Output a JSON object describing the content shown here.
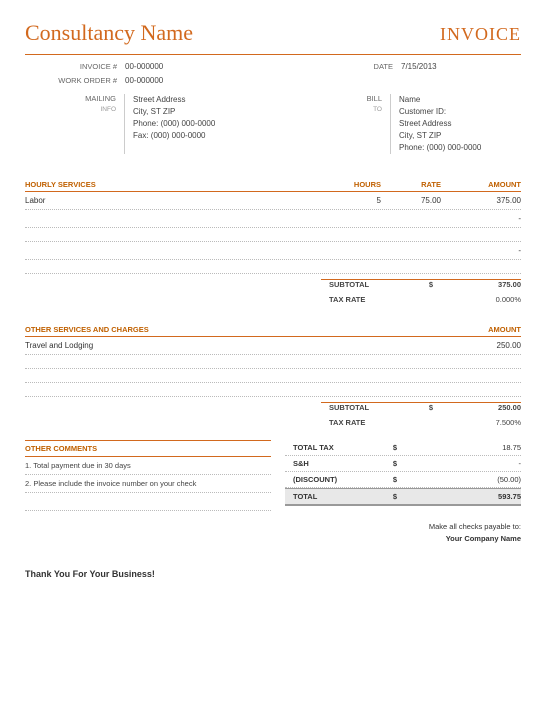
{
  "header": {
    "company_name": "Consultancy Name",
    "invoice_title": "INVOICE"
  },
  "meta": {
    "invoice_no_label": "INVOICE #",
    "invoice_no": "00-000000",
    "date_label": "DATE",
    "date": "7/15/2013",
    "work_order_label": "WORK ORDER #",
    "work_order": "00-000000"
  },
  "mailing": {
    "label": "MAILING",
    "sublabel": "INFO",
    "lines": {
      "l1": "Street Address",
      "l2": "City, ST  ZIP",
      "l3": "Phone: (000) 000-0000",
      "l4": "Fax: (000) 000-0000"
    }
  },
  "billto": {
    "label": "BILL",
    "sublabel": "TO",
    "lines": {
      "l1": "Name",
      "l2": "Customer ID:",
      "l3": "Street Address",
      "l4": "City, ST  ZIP",
      "l5": "Phone: (000) 000-0000"
    }
  },
  "hourly": {
    "header": {
      "desc": "HOURLY SERVICES",
      "hours": "HOURS",
      "rate": "RATE",
      "amount": "AMOUNT"
    },
    "rows": {
      "r1": {
        "desc": "Labor",
        "hours": "5",
        "rate": "75.00",
        "amount": "375.00"
      },
      "r2": {
        "desc": "",
        "hours": "",
        "rate": "",
        "amount": "-"
      },
      "r3": {
        "desc": "",
        "hours": "",
        "rate": "",
        "amount": ""
      },
      "r4": {
        "desc": "",
        "hours": "",
        "rate": "",
        "amount": "-"
      },
      "r5": {
        "desc": "",
        "hours": "",
        "rate": "",
        "amount": ""
      }
    },
    "subtotal_label": "SUBTOTAL",
    "subtotal_cur": "$",
    "subtotal_val": "375.00",
    "taxrate_label": "TAX RATE",
    "taxrate_val": "0.000%"
  },
  "other": {
    "header": {
      "desc": "OTHER SERVICES AND CHARGES",
      "amount": "AMOUNT"
    },
    "rows": {
      "r1": {
        "desc": "Travel and Lodging",
        "amount": "250.00"
      },
      "r2": {
        "desc": "",
        "amount": ""
      },
      "r3": {
        "desc": "",
        "amount": ""
      },
      "r4": {
        "desc": "",
        "amount": ""
      }
    },
    "subtotal_label": "SUBTOTAL",
    "subtotal_cur": "$",
    "subtotal_val": "250.00",
    "taxrate_label": "TAX RATE",
    "taxrate_val": "7.500%"
  },
  "comments": {
    "title": "OTHER COMMENTS",
    "c1": "1. Total payment due in 30 days",
    "c2": "2. Please include the invoice number on your check"
  },
  "totals": {
    "tax_label": "TOTAL TAX",
    "tax_cur": "$",
    "tax_val": "18.75",
    "sh_label": "S&H",
    "sh_cur": "$",
    "sh_val": "-",
    "disc_label": "(DISCOUNT)",
    "disc_cur": "$",
    "disc_val": "(50.00)",
    "total_label": "TOTAL",
    "total_cur": "$",
    "total_val": "593.75"
  },
  "payable": {
    "line1": "Make all checks payable to:",
    "line2": "Your Company Name"
  },
  "thanks": "Thank You For Your Business!"
}
